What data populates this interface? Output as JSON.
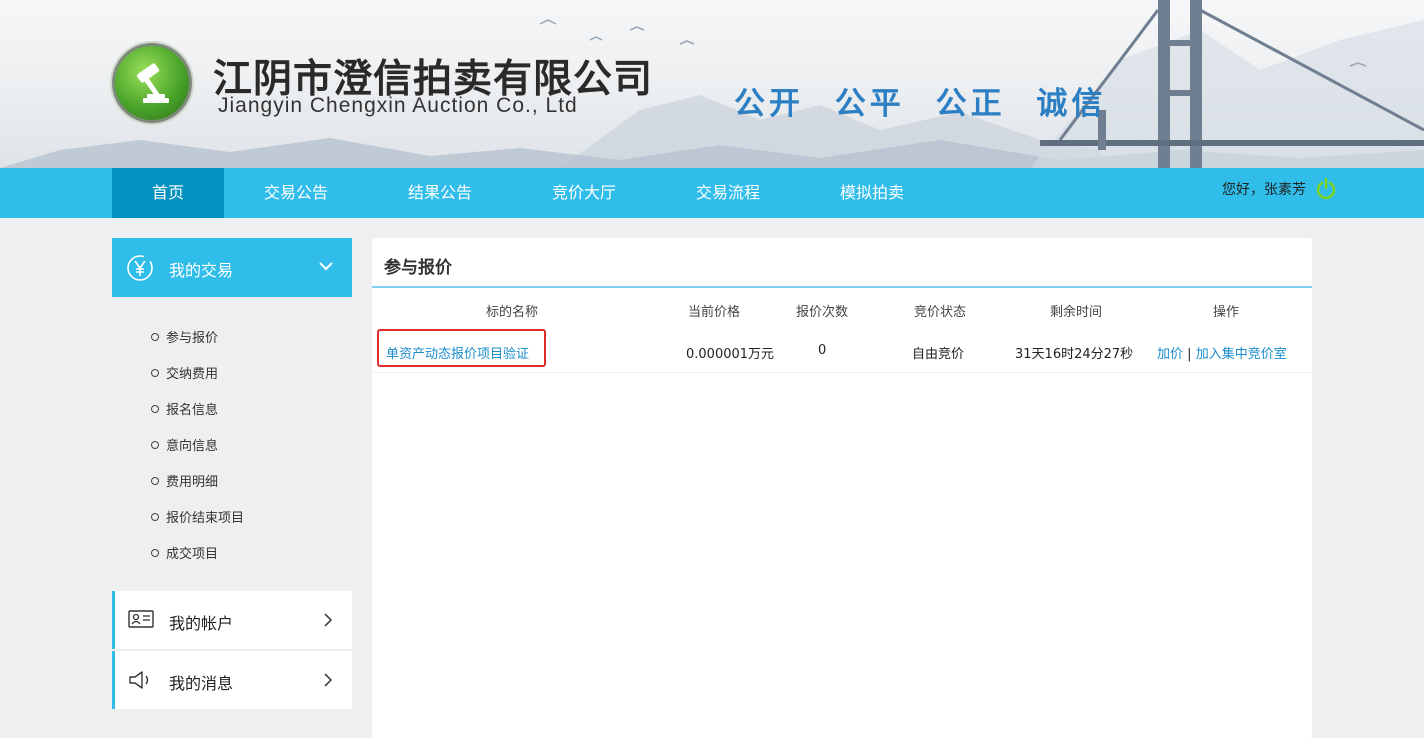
{
  "header": {
    "company_cn": "江阴市澄信拍卖有限公司",
    "company_en": "Jiangyin Chengxin Auction Co., Ltd",
    "slogan": "公开 公平 公正 诚信",
    "logo_icon": "gavel-logo-icon"
  },
  "nav": {
    "items": [
      {
        "label": "首页",
        "active": true
      },
      {
        "label": "交易公告"
      },
      {
        "label": "结果公告"
      },
      {
        "label": "竞价大厅"
      },
      {
        "label": "交易流程"
      },
      {
        "label": "模拟拍卖"
      }
    ],
    "user_greeting": "您好，张素芳",
    "logout_icon": "power-icon",
    "bar_color": "#30bdea",
    "active_color": "#0391c0"
  },
  "sidebar": {
    "my_trades": {
      "label": "我的交易",
      "icon": "yen-icon"
    },
    "items": [
      {
        "label": "参与报价"
      },
      {
        "label": "交纳费用"
      },
      {
        "label": "报名信息"
      },
      {
        "label": "意向信息"
      },
      {
        "label": "费用明细"
      },
      {
        "label": "报价结束项目"
      },
      {
        "label": "成交项目"
      }
    ],
    "my_account": {
      "label": "我的帐户",
      "icon": "id-card-icon"
    },
    "my_messages": {
      "label": "我的消息",
      "icon": "speaker-icon"
    }
  },
  "main": {
    "title": "参与报价",
    "columns": [
      "标的名称",
      "当前价格",
      "报价次数",
      "竞价状态",
      "剩余时间",
      "操作"
    ],
    "rows": [
      {
        "name": "单资产动态报价项目验证",
        "price": "0.000001万元",
        "bid_count": "0",
        "status": "自由竞价",
        "remaining": "31天16时24分27秒",
        "action_bid": "加价",
        "action_sep": "|",
        "action_room": "加入集中竞价室"
      }
    ],
    "highlight_color": "#e02b2b",
    "link_color": "#1a8ccd"
  }
}
